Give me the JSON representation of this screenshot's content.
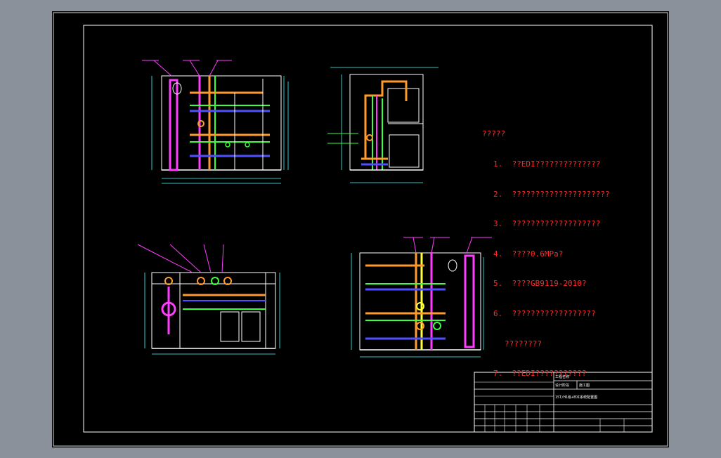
{
  "notes": {
    "title": "?????",
    "items": [
      "1.  ??EDI??????????????",
      "2.  ?????????????????????",
      "3.  ???????????????????",
      "4.  ????0.6MPa?",
      "5.  ????GB9119-2010?",
      "6.  ??????????????????",
      "????????",
      "7.  ??EDI???????????"
    ]
  },
  "title_block": {
    "project": "工程名称",
    "design_stage": "设计阶段",
    "stage_value": "施工图",
    "drawing_title": "15T/H1级+EDI系统配置图"
  },
  "colors": {
    "background": "#000000",
    "frame": "#ffffff",
    "notes_text": "#ff2a2a",
    "pipe_magenta": "#ff3dff",
    "pipe_orange": "#ff9a2e",
    "pipe_green": "#3aff3a",
    "pipe_yellow": "#ffff3a",
    "pipe_blue": "#5050ff",
    "dimension": "#3affff"
  }
}
